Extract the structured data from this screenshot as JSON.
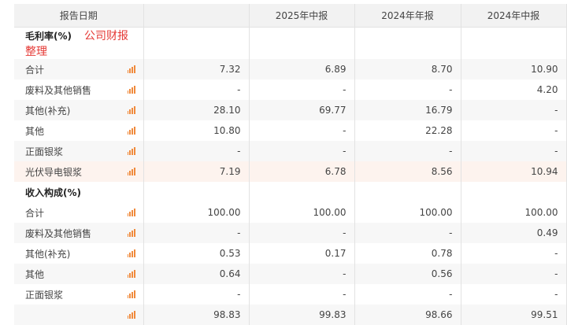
{
  "header": [
    "报告日期",
    "",
    "2025年中报",
    "2024年年报",
    "2024年中报"
  ],
  "sections": [
    {
      "title": "毛利率(%)",
      "watermark": "公司财报整理",
      "rows": [
        {
          "label": "合计",
          "values": [
            "7.32",
            "6.89",
            "8.70",
            "10.90"
          ]
        },
        {
          "label": "废料及其他销售",
          "values": [
            "-",
            "-",
            "-",
            "4.20"
          ]
        },
        {
          "label": "其他(补充)",
          "values": [
            "28.10",
            "69.77",
            "16.79",
            "-"
          ]
        },
        {
          "label": "其他",
          "values": [
            "10.80",
            "-",
            "22.28",
            "-"
          ]
        },
        {
          "label": "正面银浆",
          "values": [
            "-",
            "-",
            "-",
            "-"
          ]
        },
        {
          "label": "光伏导电银浆",
          "values": [
            "7.19",
            "6.78",
            "8.56",
            "10.94"
          ]
        }
      ]
    },
    {
      "title": "收入构成(%)",
      "watermark": "",
      "rows": [
        {
          "label": "合计",
          "values": [
            "100.00",
            "100.00",
            "100.00",
            "100.00"
          ]
        },
        {
          "label": "废料及其他销售",
          "values": [
            "-",
            "-",
            "-",
            "0.49"
          ]
        },
        {
          "label": "其他(补充)",
          "values": [
            "0.53",
            "0.17",
            "0.78",
            "-"
          ]
        },
        {
          "label": "其他",
          "values": [
            "0.64",
            "-",
            "0.56",
            "-"
          ]
        },
        {
          "label": "正面银浆",
          "values": [
            "-",
            "-",
            "-",
            "-"
          ]
        },
        {
          "label": "",
          "values": [
            "98.83",
            "99.83",
            "98.66",
            "99.51"
          ]
        }
      ]
    }
  ]
}
